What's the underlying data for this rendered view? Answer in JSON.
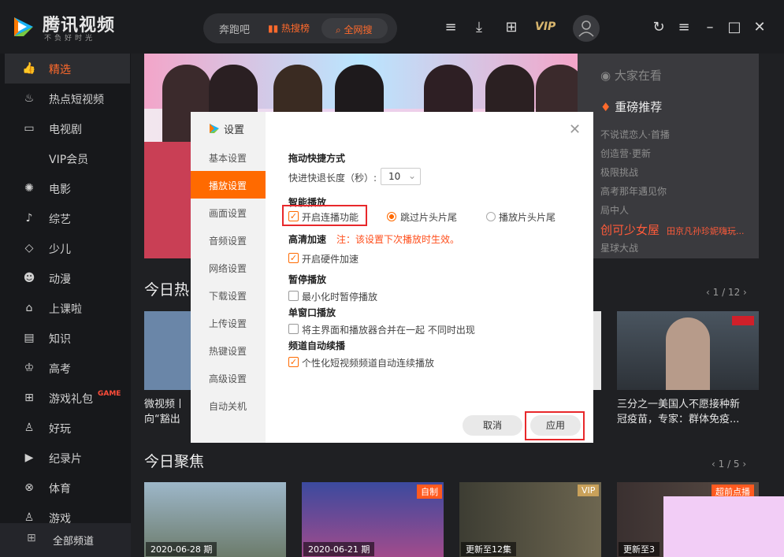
{
  "app": {
    "name": "腾讯视频",
    "slogan": "不负好时光"
  },
  "search": {
    "text": "奔跑吧",
    "hot": "热搜榜",
    "all": "全网搜"
  },
  "toolbar": {
    "vip": "VIP",
    "icons": [
      "history-icon",
      "download-icon",
      "game-controller-icon"
    ]
  },
  "window": {
    "icons": [
      "refresh-icon",
      "menu-icon",
      "minimize-icon",
      "maximize-icon",
      "close-icon"
    ]
  },
  "sidebar": {
    "items": [
      {
        "label": "精选",
        "icon": "thumb-up-icon"
      },
      {
        "label": "热点短视频",
        "icon": "flame-icon"
      },
      {
        "label": "电视剧",
        "icon": "tv-icon"
      },
      {
        "label": "VIP会员",
        "icon": ""
      },
      {
        "label": "电影",
        "icon": "film-reel-icon"
      },
      {
        "label": "综艺",
        "icon": "microphone-icon"
      },
      {
        "label": "少儿",
        "icon": "kite-icon"
      },
      {
        "label": "动漫",
        "icon": "bear-icon"
      },
      {
        "label": "上课啦",
        "icon": "graduation-cap-icon"
      },
      {
        "label": "知识",
        "icon": "book-icon"
      },
      {
        "label": "高考",
        "icon": "exam-icon"
      },
      {
        "label": "游戏礼包",
        "icon": "gamepad-icon",
        "tag": "GAME"
      },
      {
        "label": "好玩",
        "icon": "joystick-icon"
      },
      {
        "label": "纪录片",
        "icon": "camera-icon"
      },
      {
        "label": "体育",
        "icon": "ball-icon"
      },
      {
        "label": "游戏",
        "icon": "game-icon"
      }
    ],
    "all_channels": "全部频道"
  },
  "right_panel": {
    "title": "大家在看",
    "subtitle": "重磅推荐",
    "items": [
      "不说谎恋人·首播",
      "创造营·更新",
      "极限挑战",
      "高考那年遇见你",
      "局中人"
    ],
    "hot": "创可少女屋",
    "hot_sub": "田京凡孙珍妮嗨玩...",
    "last": "星球大战"
  },
  "sections": [
    {
      "title": "今日热",
      "pager": "1 / 12"
    },
    {
      "title": "今日聚焦",
      "pager": "1 / 5"
    }
  ],
  "cards_row1": [
    {
      "caption": "微视频丨\n向“豁出"
    },
    {
      "caption": "三分之一美国人不愿接种新\n冠疫苗，专家：群体免疫..."
    }
  ],
  "cards_row2": [
    {
      "date": "2020-06-28 期",
      "badge": ""
    },
    {
      "date": "2020-06-21 期",
      "badge": "自制"
    },
    {
      "date": "更新至12集",
      "badge": "VIP"
    },
    {
      "date": "更新至3",
      "badge": "超前点播"
    }
  ],
  "dialog": {
    "title": "设置",
    "tabs": [
      "基本设置",
      "播放设置",
      "画面设置",
      "音频设置",
      "网络设置",
      "下载设置",
      "上传设置",
      "热键设置",
      "高级设置",
      "自动关机"
    ],
    "active_tab": "播放设置",
    "drag_heading": "拖动快捷方式",
    "seek_label": "快进快退长度（秒）:",
    "seek_value": "10",
    "smart_heading": "智能播放",
    "opt_continuous": "开启连播功能",
    "opt_skip": "跳过片头片尾",
    "opt_play": "播放片头片尾",
    "hd_heading": "高清加速",
    "hd_note": "注：该设置下次播放时生效。",
    "hd_opt": "开启硬件加速",
    "pause_heading": "暂停播放",
    "pause_opt": "最小化时暂停播放",
    "single_heading": "单窗口播放",
    "single_opt": "将主界面和播放器合并在一起 不同时出现",
    "channel_heading": "频道自动续播",
    "channel_opt": "个性化短视频频道自动连续播放",
    "cancel": "取消",
    "apply": "应用",
    "accent": "#ff6a00"
  }
}
